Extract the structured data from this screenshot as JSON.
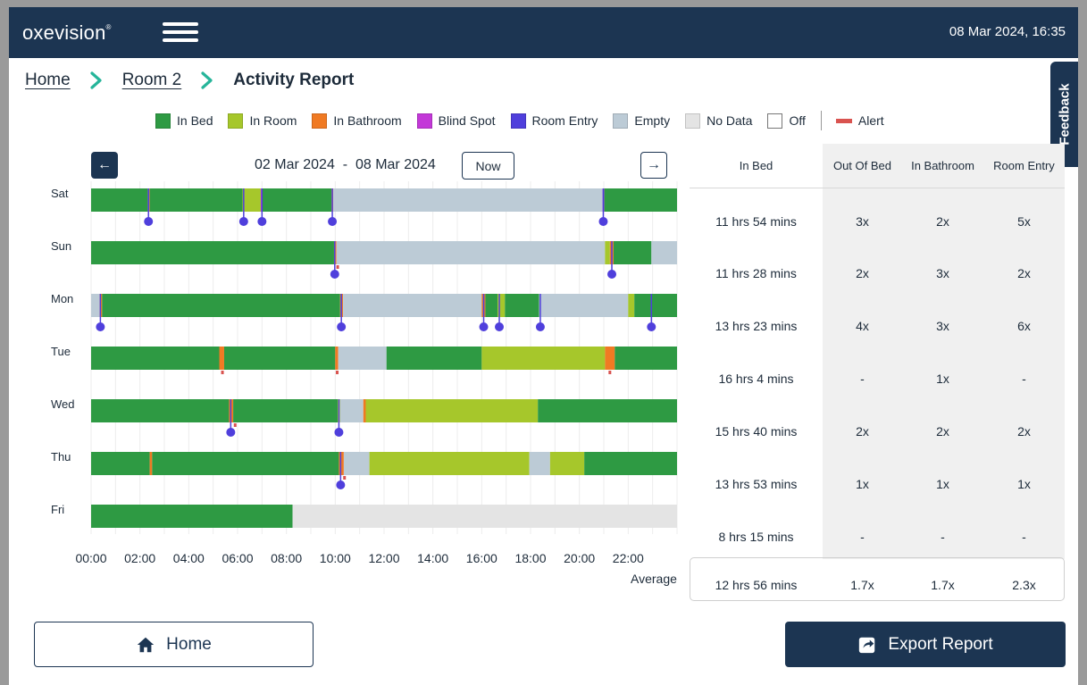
{
  "header": {
    "logo_text": "oxevision",
    "logo_mark": "®",
    "datetime": "08 Mar 2024, 16:35"
  },
  "breadcrumb": {
    "home": "Home",
    "room": "Room 2",
    "current": "Activity Report"
  },
  "feedback_label": "Feedback",
  "legend": [
    {
      "label": "In Bed",
      "color": "#2e9a43"
    },
    {
      "label": "In Room",
      "color": "#a6c72b"
    },
    {
      "label": "In Bathroom",
      "color": "#f07a23"
    },
    {
      "label": "Blind Spot",
      "color": "#c338d8"
    },
    {
      "label": "Room Entry",
      "color": "#4f3fdc"
    },
    {
      "label": "Empty",
      "color": "#bccbd6"
    },
    {
      "label": "No Data",
      "color": "#e4e4e4"
    },
    {
      "label": "Off",
      "color": "#ffffff"
    }
  ],
  "legend_alert": {
    "label": "Alert",
    "color": "#d9534f"
  },
  "week_nav": {
    "start_date": "02 Mar 2024",
    "separator": "-",
    "end_date": "08 Mar 2024",
    "now_label": "Now",
    "prev_arrow": "←",
    "next_arrow": "→"
  },
  "chart_data": {
    "type": "timeline",
    "x_ticks": [
      "00:00",
      "02:00",
      "04:00",
      "06:00",
      "08:00",
      "10:00",
      "12:00",
      "14:00",
      "16:00",
      "18:00",
      "20:00",
      "22:00"
    ],
    "x_range_hours": [
      0,
      24
    ],
    "colors": {
      "bed": "#2e9a43",
      "room": "#a6c72b",
      "bath": "#f07a23",
      "blind": "#c338d8",
      "empty": "#bccbd6",
      "nodata": "#e4e4e4",
      "entry": "#4f3fdc",
      "alert": "#d9534f"
    },
    "days": [
      {
        "label": "Sat",
        "segments": [
          [
            "bed",
            0,
            2.32
          ],
          [
            "bath",
            2.32,
            2.4
          ],
          [
            "bed",
            2.4,
            6.2
          ],
          [
            "room",
            6.2,
            6.95
          ],
          [
            "blind",
            6.95,
            7.02
          ],
          [
            "bed",
            7.02,
            9.85
          ],
          [
            "bath",
            9.85,
            9.92
          ],
          [
            "empty",
            9.92,
            20.95
          ],
          [
            "blind",
            20.95,
            21.02
          ],
          [
            "bed",
            21.02,
            24
          ]
        ],
        "entries": [
          2.35,
          6.25,
          7.0,
          9.88,
          20.98
        ],
        "alerts": []
      },
      {
        "label": "Sun",
        "segments": [
          [
            "bed",
            0,
            9.95
          ],
          [
            "bath",
            9.95,
            10.05
          ],
          [
            "empty",
            10.05,
            21.05
          ],
          [
            "room",
            21.05,
            21.25
          ],
          [
            "bath",
            21.25,
            21.4
          ],
          [
            "bed",
            21.4,
            22.95
          ],
          [
            "empty",
            22.95,
            24
          ]
        ],
        "entries": [
          9.98,
          21.33
        ],
        "alerts": [
          10.1
        ]
      },
      {
        "label": "Mon",
        "segments": [
          [
            "empty",
            0,
            0.35
          ],
          [
            "bath",
            0.35,
            0.45
          ],
          [
            "bed",
            0.45,
            10.2
          ],
          [
            "bath",
            10.2,
            10.32
          ],
          [
            "empty",
            10.32,
            16.0
          ],
          [
            "bath",
            16.0,
            16.15
          ],
          [
            "bed",
            16.15,
            16.65
          ],
          [
            "room",
            16.65,
            16.95
          ],
          [
            "bed",
            16.95,
            18.35
          ],
          [
            "empty",
            18.35,
            22.0
          ],
          [
            "room",
            22.0,
            22.25
          ],
          [
            "bed",
            22.25,
            24
          ]
        ],
        "entries": [
          0.38,
          10.25,
          16.08,
          16.72,
          18.4,
          22.95
        ],
        "alerts": []
      },
      {
        "label": "Tue",
        "segments": [
          [
            "bed",
            0,
            5.25
          ],
          [
            "bath",
            5.25,
            5.45
          ],
          [
            "bed",
            5.45,
            10.0
          ],
          [
            "bath",
            10.0,
            10.12
          ],
          [
            "empty",
            10.12,
            12.1
          ],
          [
            "bed",
            12.1,
            16.0
          ],
          [
            "room",
            16.0,
            21.05
          ],
          [
            "bath",
            21.05,
            21.45
          ],
          [
            "bed",
            21.45,
            24
          ]
        ],
        "entries": [],
        "alerts": [
          5.38,
          10.08,
          21.25
        ]
      },
      {
        "label": "Wed",
        "segments": [
          [
            "bed",
            0,
            5.65
          ],
          [
            "bath",
            5.65,
            5.82
          ],
          [
            "bed",
            5.82,
            10.1
          ],
          [
            "room",
            10.1,
            10.2
          ],
          [
            "empty",
            10.2,
            11.15
          ],
          [
            "bath",
            11.15,
            11.25
          ],
          [
            "room",
            11.25,
            18.3
          ],
          [
            "bed",
            18.3,
            24
          ]
        ],
        "entries": [
          5.72,
          10.15
        ],
        "alerts": [
          5.9
        ]
      },
      {
        "label": "Thu",
        "segments": [
          [
            "bed",
            0,
            2.4
          ],
          [
            "bath",
            2.4,
            2.5
          ],
          [
            "bed",
            2.5,
            10.15
          ],
          [
            "bath",
            10.15,
            10.35
          ],
          [
            "empty",
            10.35,
            11.4
          ],
          [
            "room",
            11.4,
            17.95
          ],
          [
            "empty",
            17.95,
            18.8
          ],
          [
            "room",
            18.8,
            20.2
          ],
          [
            "bed",
            20.2,
            24
          ]
        ],
        "entries": [
          10.22
        ],
        "alerts": [
          10.38
        ]
      },
      {
        "label": "Fri",
        "segments": [
          [
            "bed",
            0,
            8.25
          ],
          [
            "nodata",
            8.25,
            24
          ]
        ],
        "entries": [],
        "alerts": []
      }
    ]
  },
  "stats": {
    "headers": [
      "In Bed",
      "Out Of Bed",
      "In Bathroom",
      "Room Entry"
    ],
    "rows": [
      [
        "11 hrs 54 mins",
        "3x",
        "2x",
        "5x"
      ],
      [
        "11 hrs 28 mins",
        "2x",
        "3x",
        "2x"
      ],
      [
        "13 hrs 23 mins",
        "4x",
        "3x",
        "6x"
      ],
      [
        "16 hrs 4 mins",
        "-",
        "1x",
        "-"
      ],
      [
        "15 hrs 40 mins",
        "2x",
        "2x",
        "2x"
      ],
      [
        "13 hrs 53 mins",
        "1x",
        "1x",
        "1x"
      ],
      [
        "8 hrs 15 mins",
        "-",
        "-",
        "-"
      ]
    ],
    "average_label": "Average",
    "average": [
      "12 hrs 56 mins",
      "1.7x",
      "1.7x",
      "2.3x"
    ]
  },
  "actions": {
    "home_label": "Home",
    "export_label": "Export Report"
  },
  "icons": {
    "menu": "hamburger-menu-icon",
    "breadcrumb_separator": "chevron-right-icon",
    "home": "home-icon",
    "export": "share-export-icon"
  }
}
